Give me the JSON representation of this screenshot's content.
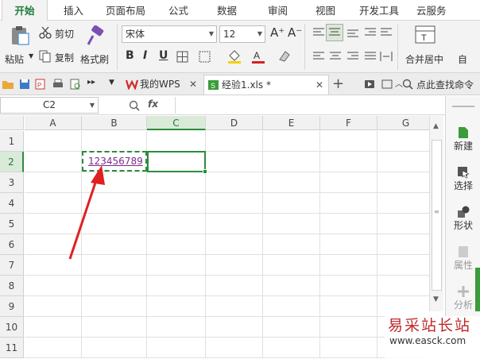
{
  "tabs": [
    "开始",
    "插入",
    "页面布局",
    "公式",
    "数据",
    "审阅",
    "视图",
    "开发工具",
    "云服务"
  ],
  "ribbon": {
    "paste": "粘贴",
    "cut": "剪切",
    "copy": "复制",
    "format_painter": "格式刷",
    "font_name": "宋体",
    "font_size": "12",
    "bold": "B",
    "italic": "I",
    "underline": "U",
    "font_grow": "A⁺",
    "font_shrink": "A⁻",
    "merge_center": "合并居中",
    "auto": "自"
  },
  "doc_tabs": [
    {
      "label": "我的WPS"
    },
    {
      "label": "经验1.xls *"
    }
  ],
  "search_label": "点此查找命令",
  "formula_bar": {
    "name_box": "C2",
    "fx": "fx",
    "value": ""
  },
  "columns": [
    "A",
    "B",
    "C",
    "D",
    "E",
    "F",
    "G"
  ],
  "rows": [
    "1",
    "2",
    "3",
    "4",
    "5",
    "6",
    "7",
    "8",
    "9",
    "10",
    "11"
  ],
  "cells": {
    "B2": "123456789"
  },
  "active_cell": "C2",
  "right_panel": [
    {
      "label": "新建"
    },
    {
      "label": "选择"
    },
    {
      "label": "形状"
    },
    {
      "label": "属性"
    },
    {
      "label": "分析"
    }
  ],
  "watermark": {
    "line1": "易采站长站",
    "line2": "www.easck.com"
  },
  "colors": {
    "accent": "#2e8b3e",
    "arrow": "#e02020",
    "cell_text": "#7b2a8c"
  }
}
